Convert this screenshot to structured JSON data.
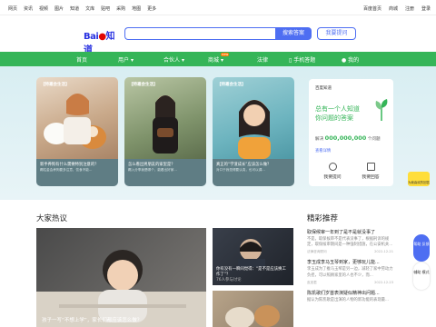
{
  "topnav": {
    "links": [
      "网页",
      "资讯",
      "视频",
      "图片",
      "知道",
      "文库",
      "贴吧",
      "采购",
      "地图",
      "更多"
    ],
    "right": [
      "百度首页",
      "商城",
      "注册",
      "登录"
    ]
  },
  "header": {
    "logo": "Bai",
    "logo_mark": "知道",
    "search_button": "搜索答案",
    "ask_button": "我要提问"
  },
  "green_nav": {
    "items": [
      "首页",
      "用户",
      "合伙人",
      "商城",
      "法律",
      "手机答题",
      "我的"
    ],
    "new_badge": "new"
  },
  "banner": {
    "cards": [
      {
        "tag": "【特邀会生活】 ",
        "caption": "新手养狗有什么需要特别注意的？",
        "sub": "踢柱金会养狗要多注意，饮食不能..."
      },
      {
        "tag": "【特邀会生活】 ",
        "caption": "怎么看出男朋友的家里是？",
        "sub": "踢入分享我是哪个，能看出好家..."
      },
      {
        "tag": "【特邀会生活】 ",
        "caption": "真正的“学渣成长”应该怎么做？",
        "sub": "对口于我觉得要认真，也可以调..."
      }
    ],
    "side_panel": {
      "title": "百度知道",
      "headline_1": "总有一个人知道",
      "headline_2": "你问题的答案",
      "count_prefix": "解决",
      "count_value": "000,000,000",
      "count_suffix": "个问题",
      "link": "查看详情",
      "action_ask": "我要提问",
      "action_answer": "我要回答"
    }
  },
  "hot": {
    "title": "大家热议",
    "main_caption": "孩子一写“不想上学”，家长们都应该怎么做？",
    "side_caption": "你有没有一瞬间觉得：“是不是应该换工作了”？",
    "side_meta": "76人参与讨论"
  },
  "recommend": {
    "title": "精彩推荐",
    "items": [
      {
        "title": "取保候审一年到了是不是就没事了",
        "desc": "不是。取保候审不是代表没事了，根据刑诉的规定，取保候审期间是一种强制措施，在公安机关...",
        "author": "法律咨询顾问",
        "date": "2022-12-21"
      },
      {
        "title": "李玉成李马玉琴到家，更够玩儿能...",
        "desc": "李玉成为了推马玉琴是另一边，减轻了家中劳动力负担，可以照顾家里的人也不少，而...",
        "author": "皮皮君",
        "date": "2022-12-23"
      },
      {
        "title": "陈凯歌们岁首表演疑似精神出问题...",
        "desc": "据认为陈凯歌是出演的人物的新功能的表现最...",
        "author": "",
        "date": ""
      }
    ]
  },
  "floaters": {
    "promo": "为我喜欢的回答",
    "help": "帮助\n反馈",
    "mode": "辅助\n模式"
  }
}
